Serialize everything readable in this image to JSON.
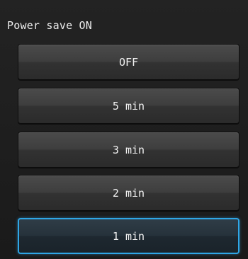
{
  "screen": {
    "title": "Power save ON"
  },
  "options": [
    {
      "label": "OFF"
    },
    {
      "label": "5 min"
    },
    {
      "label": "3 min"
    },
    {
      "label": "2 min"
    },
    {
      "label": "1 min"
    }
  ],
  "selected_option": "1 min",
  "colors": {
    "selection_border": "#2fa6e6"
  }
}
